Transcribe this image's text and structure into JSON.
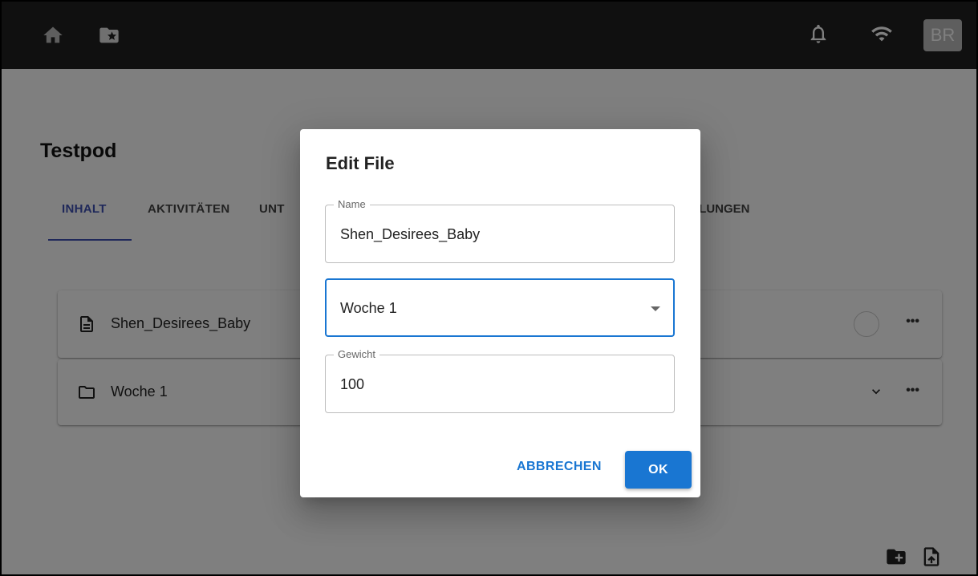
{
  "topbar": {
    "avatar_initials": "BR",
    "icons": [
      "home-icon",
      "starred-folder-icon",
      "bell-icon",
      "wifi-icon"
    ]
  },
  "page": {
    "title": "Testpod",
    "tabs": [
      {
        "label": "INHALT",
        "active": true
      },
      {
        "label": "AKTIVITÄTEN",
        "active": false
      },
      {
        "label": "UNT",
        "active": false
      }
    ],
    "tab_right_visible": "LLUNGEN"
  },
  "items": [
    {
      "label": "Shen_Desirees_Baby",
      "icon": "document-icon"
    },
    {
      "label": "Woche 1",
      "icon": "folder-icon"
    }
  ],
  "dialog": {
    "title": "Edit File",
    "name_field": {
      "label": "Name",
      "value": "Shen_Desirees_Baby"
    },
    "folder_select": {
      "value": "Woche 1"
    },
    "weight_field": {
      "label": "Gewicht",
      "value": "100"
    },
    "cancel_label": "ABBRECHEN",
    "ok_label": "OK"
  },
  "colors": {
    "topbar": "#212121",
    "accent": "#1976d2",
    "tab_active": "#3f51b5"
  }
}
